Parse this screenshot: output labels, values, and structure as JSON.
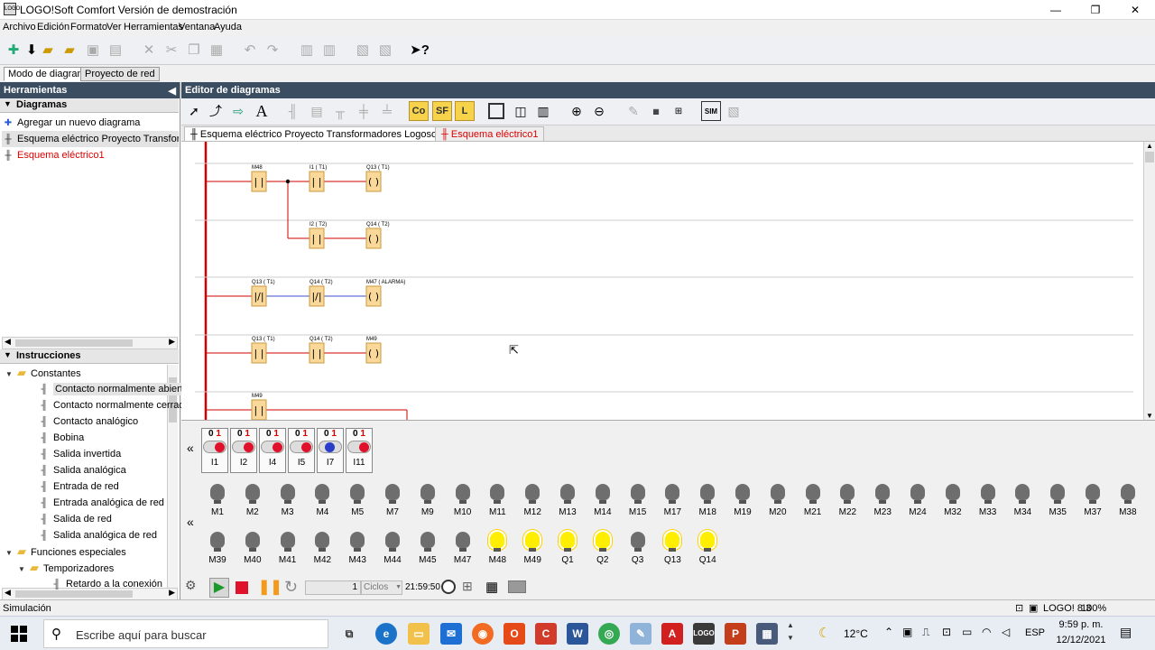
{
  "window": {
    "title": "LOGO!Soft Comfort Versión de demostración",
    "min": "—",
    "max": "❐",
    "close": "✕",
    "icon_text": "LOGO"
  },
  "menu": [
    "Archivo",
    "Edición",
    "Formato",
    "Ver",
    "Herramientas",
    "Ventana",
    "Ayuda"
  ],
  "toolbar": {
    "help_label": "?"
  },
  "modes": {
    "diagram": "Modo de diagrama",
    "network": "Proyecto de red"
  },
  "left": {
    "header": "Herramientas",
    "diagrams_title": "Diagramas",
    "diagrams": [
      "Agregar un nuevo diagrama",
      "Esquema eléctrico Proyecto Transformadores",
      "Esquema eléctrico1"
    ],
    "instructions_title": "Instrucciones",
    "tree": [
      {
        "label": "Constantes",
        "level": 0,
        "kind": "folder"
      },
      {
        "label": "Contacto normalmente abierto",
        "level": 1,
        "kind": "item",
        "selected": true
      },
      {
        "label": "Contacto normalmente cerrado",
        "level": 1,
        "kind": "item"
      },
      {
        "label": "Contacto analógico",
        "level": 1,
        "kind": "item"
      },
      {
        "label": "Bobina",
        "level": 1,
        "kind": "item"
      },
      {
        "label": "Salida invertida",
        "level": 1,
        "kind": "item"
      },
      {
        "label": "Salida analógica",
        "level": 1,
        "kind": "item"
      },
      {
        "label": "Entrada de red",
        "level": 1,
        "kind": "item"
      },
      {
        "label": "Entrada analógica de red",
        "level": 1,
        "kind": "item"
      },
      {
        "label": "Salida de red",
        "level": 1,
        "kind": "item"
      },
      {
        "label": "Salida analógica de red",
        "level": 1,
        "kind": "item"
      },
      {
        "label": "Funciones especiales",
        "level": 0,
        "kind": "folder"
      },
      {
        "label": "Temporizadores",
        "level": 1,
        "kind": "folder"
      },
      {
        "label": "Retardo a la conexión",
        "level": 2,
        "kind": "item"
      }
    ]
  },
  "editor": {
    "header": "Editor de diagramas",
    "tb_co": "Co",
    "tb_sf": "SF",
    "tb_l": "L",
    "tb_sim": "SIM",
    "tabs": [
      "Esquema eléctrico Proyecto Transformadores Logosoft.lld",
      "Esquema eléctrico1"
    ]
  },
  "ladder": {
    "rungs": [
      [
        {
          "t": "NO",
          "l": "M48"
        },
        {
          "t": "NO",
          "l": "I1 ( T1)"
        },
        {
          "t": "COIL",
          "l": "Q13 ( T1)"
        }
      ],
      [
        {
          "t": "NO",
          "l": "I2 ( T2)"
        },
        {
          "t": "COIL",
          "l": "Q14 ( T2)"
        }
      ],
      [
        {
          "t": "NC",
          "l": "Q13 ( T1)"
        },
        {
          "t": "NC",
          "l": "Q14 ( T2)"
        },
        {
          "t": "COIL",
          "l": "M47 ( ALARMA)"
        }
      ],
      [
        {
          "t": "NO",
          "l": "Q13 ( T1)"
        },
        {
          "t": "NO",
          "l": "Q14 ( T2)"
        },
        {
          "t": "COIL",
          "l": "M49"
        }
      ],
      [
        {
          "t": "NO",
          "l": "M49"
        }
      ]
    ]
  },
  "sim": {
    "collapse": "«",
    "switches": [
      {
        "n": "I1",
        "on": true
      },
      {
        "n": "I2",
        "on": true
      },
      {
        "n": "I4",
        "on": true
      },
      {
        "n": "I5",
        "on": true
      },
      {
        "n": "I7",
        "on": false
      },
      {
        "n": "I11",
        "on": true
      }
    ],
    "row1": [
      {
        "n": "M1"
      },
      {
        "n": "M2"
      },
      {
        "n": "M3"
      },
      {
        "n": "M4"
      },
      {
        "n": "M5"
      },
      {
        "n": "M7"
      },
      {
        "n": "M9"
      },
      {
        "n": "M10"
      },
      {
        "n": "M11"
      },
      {
        "n": "M12"
      },
      {
        "n": "M13"
      },
      {
        "n": "M14"
      },
      {
        "n": "M15"
      },
      {
        "n": "M17"
      },
      {
        "n": "M18"
      },
      {
        "n": "M19"
      },
      {
        "n": "M20"
      },
      {
        "n": "M21"
      },
      {
        "n": "M22"
      },
      {
        "n": "M23"
      },
      {
        "n": "M24"
      },
      {
        "n": "M32"
      },
      {
        "n": "M33"
      },
      {
        "n": "M34"
      },
      {
        "n": "M35"
      },
      {
        "n": "M37"
      },
      {
        "n": "M38"
      }
    ],
    "row2": [
      {
        "n": "M39"
      },
      {
        "n": "M40"
      },
      {
        "n": "M41"
      },
      {
        "n": "M42"
      },
      {
        "n": "M43"
      },
      {
        "n": "M44"
      },
      {
        "n": "M45"
      },
      {
        "n": "M47"
      },
      {
        "n": "M48",
        "on": true
      },
      {
        "n": "M49",
        "on": true
      },
      {
        "n": "Q1",
        "on": true
      },
      {
        "n": "Q2",
        "on": true
      },
      {
        "n": "Q3"
      },
      {
        "n": "Q13",
        "on": true
      },
      {
        "n": "Q14",
        "on": true
      }
    ],
    "cycles_value": "1",
    "cycles_unit": "Ciclos",
    "time": "21:59:50"
  },
  "status": {
    "left": "Simulación",
    "right": "LOGO! 8.3",
    "zoom": "100%"
  },
  "taskbar": {
    "search": "Escribe aquí para buscar",
    "temp": "12°C",
    "lang": "ESP",
    "time": "9:59 p. m.",
    "date": "12/12/2021"
  },
  "colors": {
    "dark_header": "#3b4d61",
    "accent_red": "#e0112b",
    "contact_fill": "#f9d89a",
    "bulb_on": "#ffee00"
  }
}
